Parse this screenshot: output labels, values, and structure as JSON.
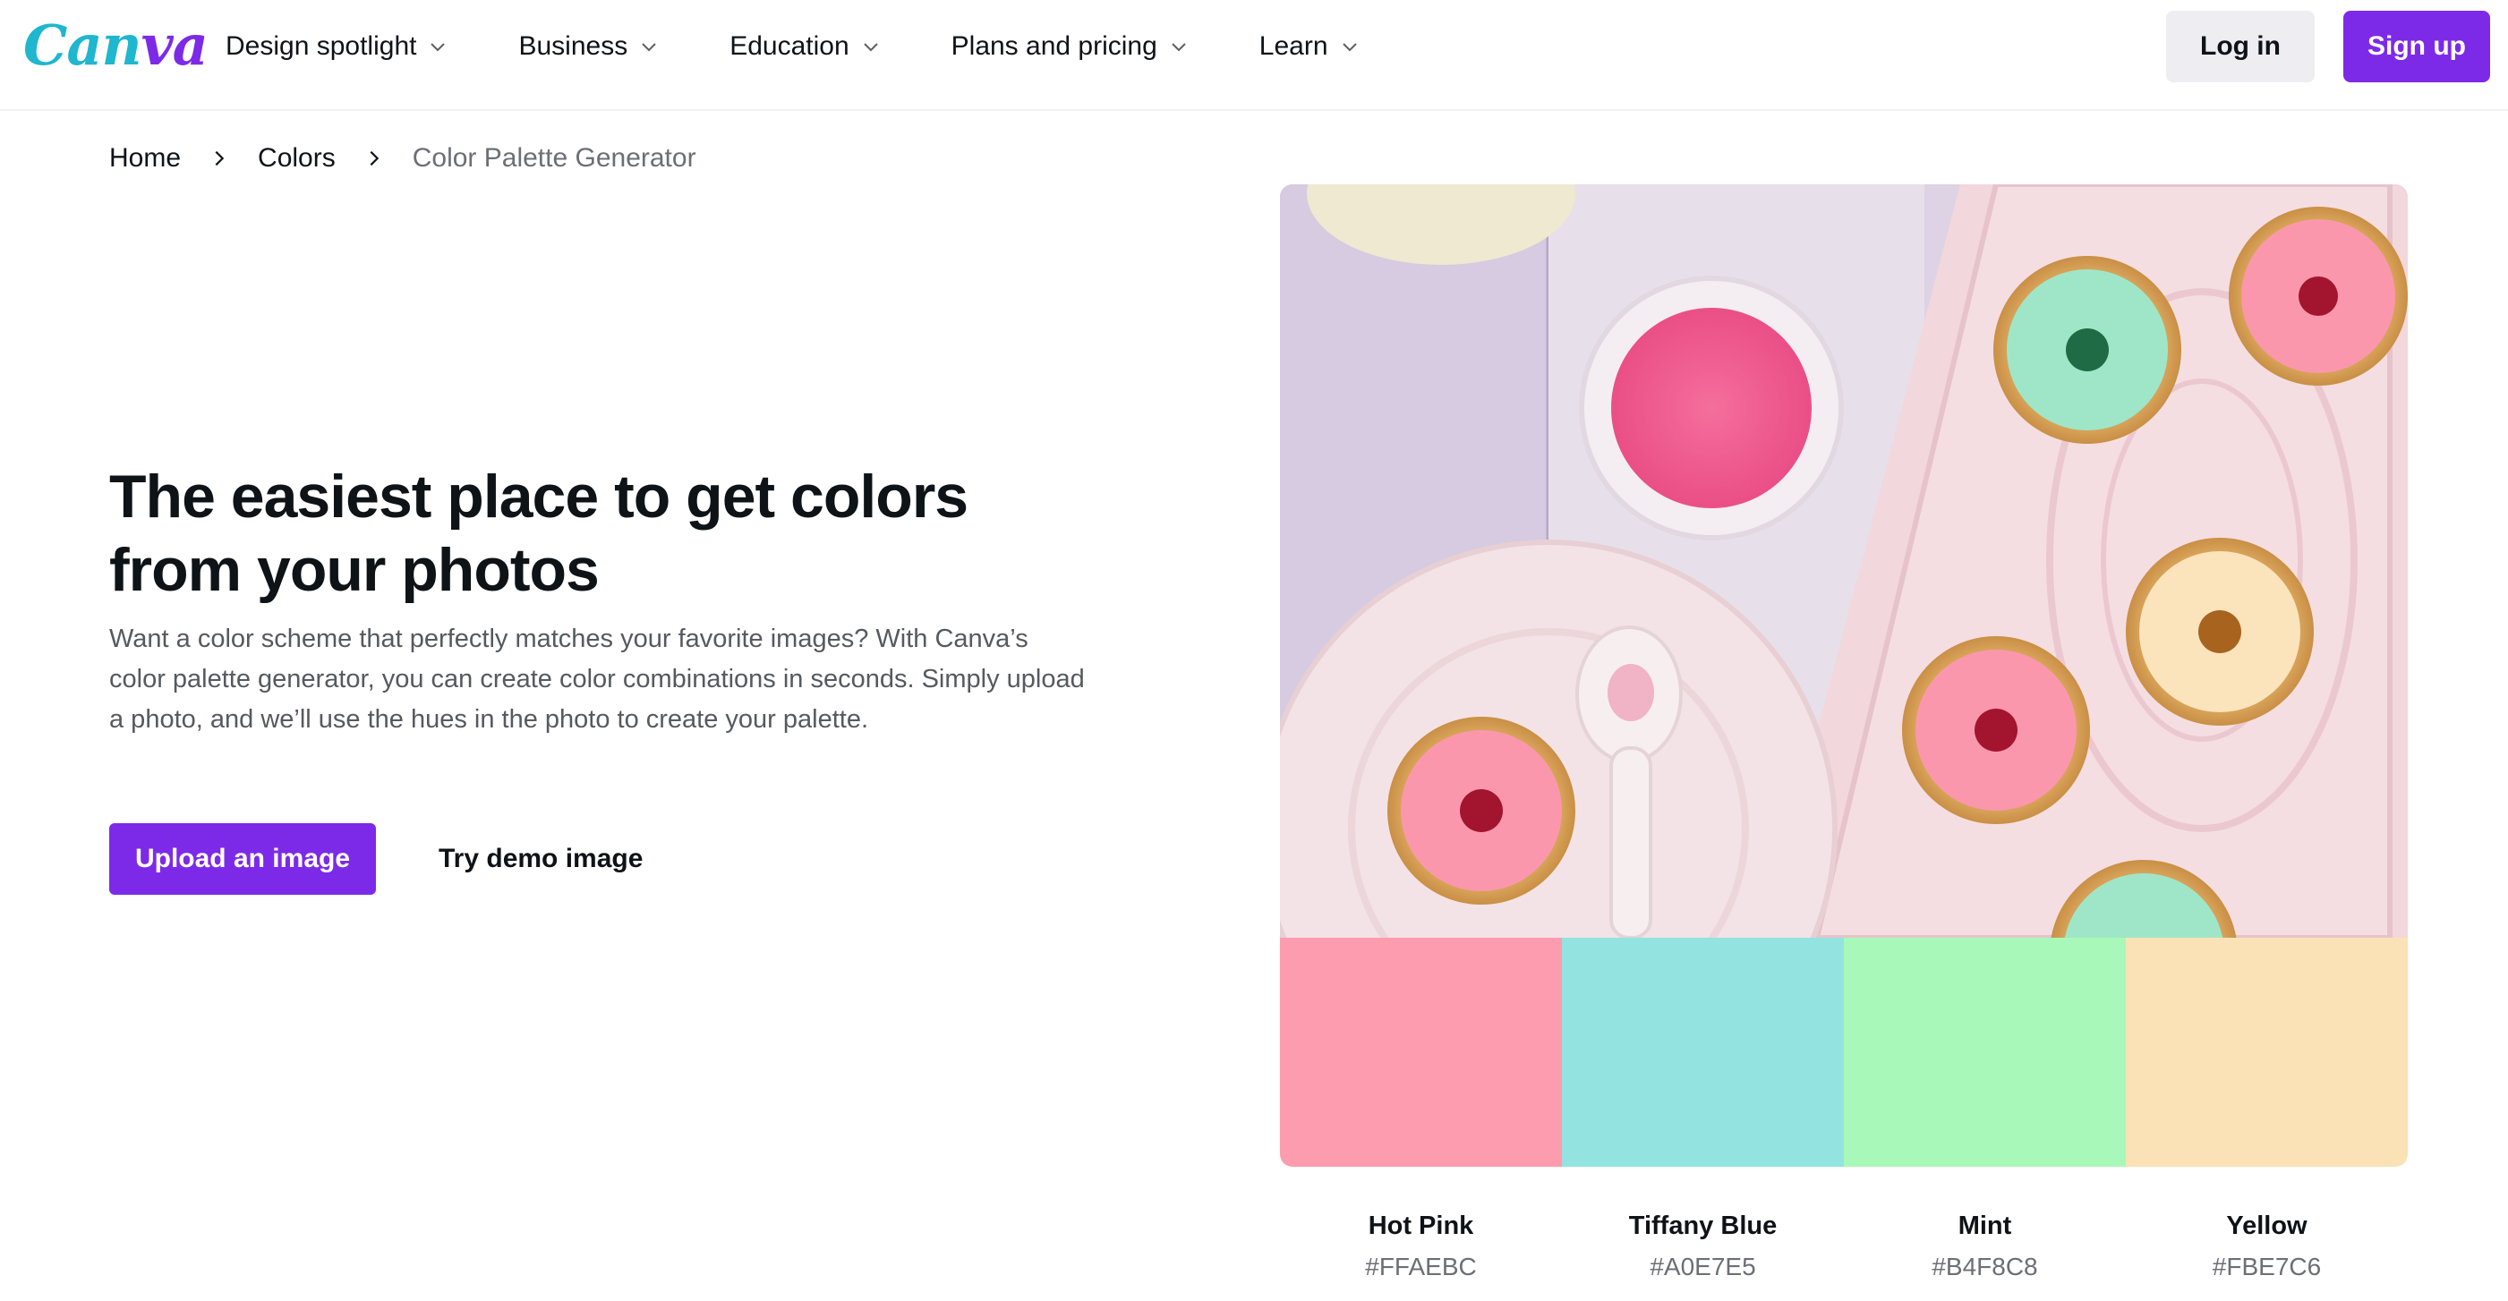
{
  "brand": {
    "logo_text_a": "Can",
    "logo_text_b": "va"
  },
  "nav": {
    "items": [
      {
        "label": "Design spotlight"
      },
      {
        "label": "Business"
      },
      {
        "label": "Education"
      },
      {
        "label": "Plans and pricing"
      },
      {
        "label": "Learn"
      }
    ],
    "login_label": "Log in",
    "signup_label": "Sign up"
  },
  "breadcrumb": {
    "items": [
      "Home",
      "Colors",
      "Color Palette Generator"
    ]
  },
  "hero": {
    "title": "The easiest place to get colors from your photos",
    "description": "Want a color scheme that perfectly matches your favorite images? With Canva’s color palette generator, you can create color combinations in seconds. Simply upload a photo, and we’ll use the hues in the photo to create your palette.",
    "upload_label": "Upload an image",
    "demo_label": "Try demo image"
  },
  "palette": {
    "colors": [
      {
        "name": "Hot Pink",
        "hex": "#FFAEBC",
        "swatch": "#fd9cae"
      },
      {
        "name": "Tiffany Blue",
        "hex": "#A0E7E5",
        "swatch": "#93e3e0"
      },
      {
        "name": "Mint",
        "hex": "#B4F8C8",
        "swatch": "#a8f8b9"
      },
      {
        "name": "Yellow",
        "hex": "#FBE7C6",
        "swatch": "#fae2b6"
      }
    ]
  },
  "colors": {
    "accent": "#7d2ae8",
    "logo_teal": "#1fb6cf",
    "text": "#0e1318",
    "muted": "#6b6f76"
  }
}
